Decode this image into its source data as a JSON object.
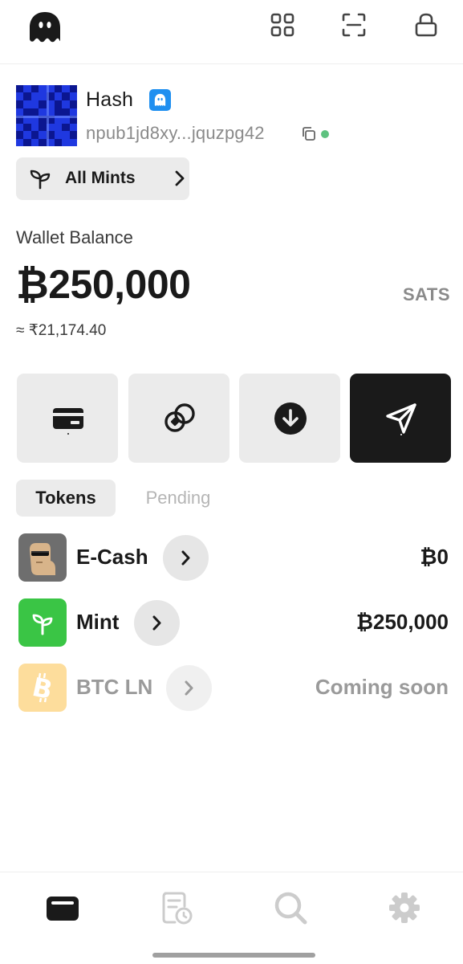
{
  "header": {
    "logo_icon": "ghost-icon",
    "actions": [
      {
        "icon": "grid-icon"
      },
      {
        "icon": "scan-icon"
      },
      {
        "icon": "lock-icon"
      }
    ]
  },
  "profile": {
    "name": "Hash",
    "verified_icon": "ghost-badge-icon",
    "npub": "npub1jd8xy...jquzpg42",
    "status_color": "#5ec27f"
  },
  "mints_button": {
    "label": "All Mints"
  },
  "wallet": {
    "label": "Wallet Balance",
    "balance": "₿250,000",
    "unit": "SATS",
    "fiat": "≈ ₹21,174.40"
  },
  "actions": [
    {
      "icon": "wallet-card-icon"
    },
    {
      "icon": "swap-icon"
    },
    {
      "icon": "receive-icon"
    },
    {
      "icon": "send-icon"
    }
  ],
  "tabs": [
    {
      "label": "Tokens",
      "active": true
    },
    {
      "label": "Pending",
      "active": false
    }
  ],
  "tokens": [
    {
      "name": "E-Cash",
      "value": "₿0",
      "icon": "ecash-avatar-icon"
    },
    {
      "name": "Mint",
      "value": "₿250,000",
      "icon": "sprout-icon",
      "color": "#3ac545"
    },
    {
      "name": "BTC LN",
      "value": "Coming soon",
      "icon": "bitcoin-icon",
      "color": "#fcbc3b"
    }
  ],
  "bottom_nav": [
    {
      "icon": "wallet-icon",
      "active": true
    },
    {
      "icon": "receipt-history-icon"
    },
    {
      "icon": "search-icon"
    },
    {
      "icon": "settings-gear-icon"
    }
  ],
  "colors": {
    "accent_dark": "#1a1a1a",
    "surface": "#ebebeb",
    "muted_text": "#8a8a8a",
    "verified_blue": "#1f8ff0"
  }
}
